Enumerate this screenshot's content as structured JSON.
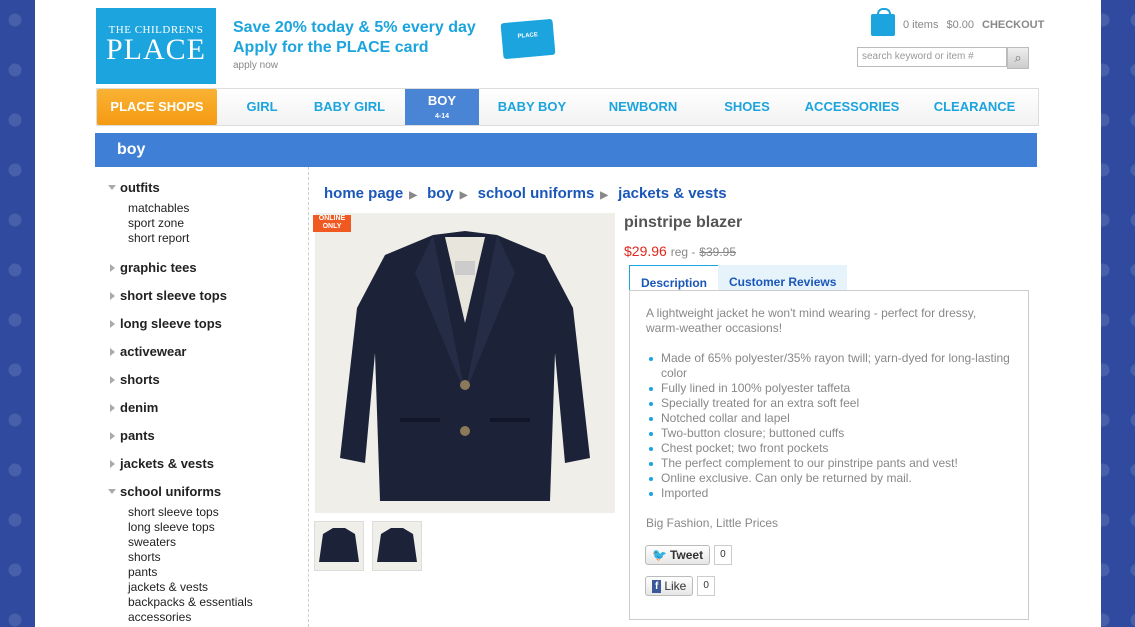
{
  "logo": {
    "line1": "THE CHILDREN'S",
    "line2": "PLACE"
  },
  "promo": {
    "line1": "Save 20% today & 5% every day",
    "line2": "Apply for the PLACE card",
    "apply": "apply now",
    "card_text": "PLACE"
  },
  "cart": {
    "items": "0 items",
    "total": "$0.00",
    "checkout": "CHECKOUT"
  },
  "search": {
    "placeholder": "search keyword or item #"
  },
  "nav": {
    "place": "PLACE SHOPS",
    "girl": "GIRL",
    "babygirl": "BABY GIRL",
    "boy": "BOY",
    "boy_sub": "4-14",
    "babyboy": "BABY BOY",
    "newborn": "NEWBORN",
    "shoes": "SHOES",
    "accessories": "ACCESSORIES",
    "clearance": "CLEARANCE"
  },
  "band": {
    "title": "boy"
  },
  "sidebar": {
    "outfits": "outfits",
    "matchables": "matchables",
    "sportzone": "sport zone",
    "shortreport": "short report",
    "graphictees": "graphic tees",
    "shortsleeve": "short sleeve tops",
    "longsleeve": "long sleeve tops",
    "activewear": "activewear",
    "shorts": "shorts",
    "denim": "denim",
    "pants": "pants",
    "jackets": "jackets & vests",
    "uniforms": "school uniforms",
    "u1": "short sleeve tops",
    "u2": "long sleeve tops",
    "u3": "sweaters",
    "u4": "shorts",
    "u5": "pants",
    "u6": "jackets & vests",
    "u7": "backpacks & essentials",
    "u8": "accessories"
  },
  "crumbs": {
    "c1": "home page",
    "c2": "boy",
    "c3": "school uniforms",
    "c4": "jackets & vests"
  },
  "product": {
    "badge1": "ONLINE",
    "badge2": "ONLY",
    "title": "pinstripe blazer",
    "price": "$29.96",
    "reg": "reg -",
    "was": "$39.95",
    "tab_desc": "Description",
    "tab_reviews": "Customer Reviews",
    "intro": "A lightweight jacket he won't mind wearing - perfect for dressy, warm-weather occasions!",
    "bullets": [
      "Made of 65% polyester/35% rayon twill; yarn-dyed for long-lasting color",
      "Fully lined in 100% polyester taffeta",
      "Specially treated for an extra soft feel",
      "Notched collar and lapel",
      "Two-button closure; buttoned cuffs",
      "Chest pocket; two front pockets",
      "The perfect complement to our pinstripe pants and vest!",
      "Online exclusive. Can only be returned by mail.",
      "Imported"
    ],
    "tagline": "Big Fashion, Little Prices",
    "tweet": "Tweet",
    "tweet_count": "0",
    "like": "Like",
    "like_count": "0"
  }
}
